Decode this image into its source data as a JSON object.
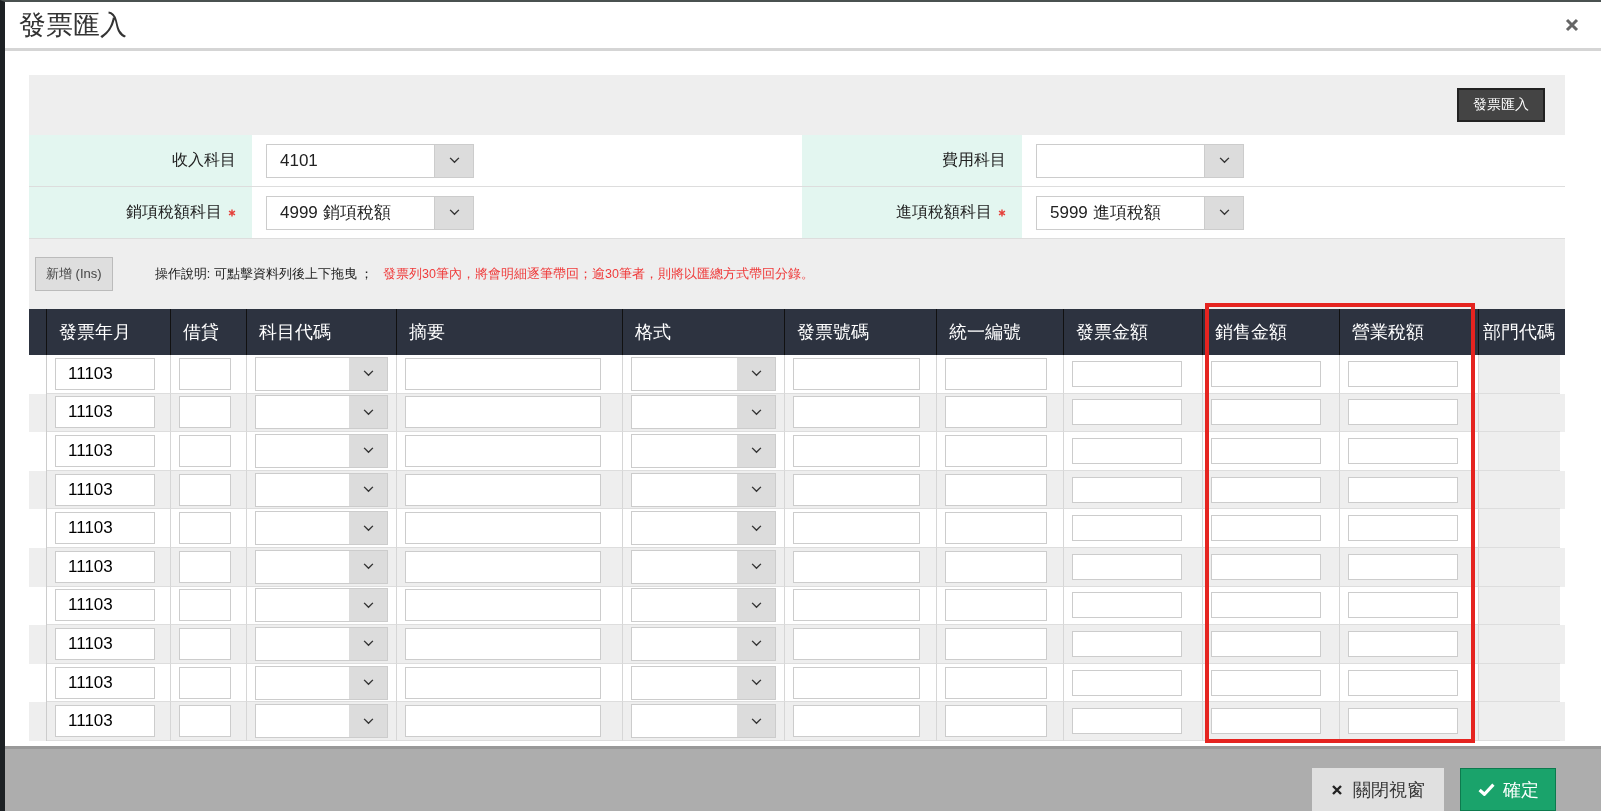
{
  "window": {
    "title": "發票匯入"
  },
  "import_button": "發票匯入",
  "form": [
    {
      "label": "收入科目",
      "required": false,
      "value": "4101"
    },
    {
      "label": "費用科目",
      "required": false
    },
    {
      "label": "銷項稅額科目",
      "required": true,
      "value": "4999 銷項稅額"
    },
    {
      "label": "進項稅額科目",
      "required": true,
      "value": "5999 進項稅額"
    }
  ],
  "toolbar": {
    "add_button": "新增 (Ins)",
    "instructions": "操作說明: 可點擊資料列後上下拖曳 ；",
    "warning": "發票列30筆內，將會明細逐筆帶回；逾30筆者，則將以匯總方式帶回分錄。"
  },
  "table": {
    "columns": [
      "發票年月",
      "借貸",
      "科目代碼",
      "摘要",
      "格式",
      "發票號碼",
      "統一編號",
      "發票金額",
      "銷售金額",
      "營業稅額",
      "部門代碼"
    ],
    "rows": [
      {
        "year_month": "11103"
      },
      {
        "year_month": "11103"
      },
      {
        "year_month": "11103"
      },
      {
        "year_month": "11103"
      },
      {
        "year_month": "11103"
      },
      {
        "year_month": "11103"
      },
      {
        "year_month": "11103"
      },
      {
        "year_month": "11103"
      },
      {
        "year_month": "11103"
      },
      {
        "year_month": "11103"
      }
    ]
  },
  "footer": {
    "close_button": "關閉視窗",
    "confirm_button": "確定"
  }
}
